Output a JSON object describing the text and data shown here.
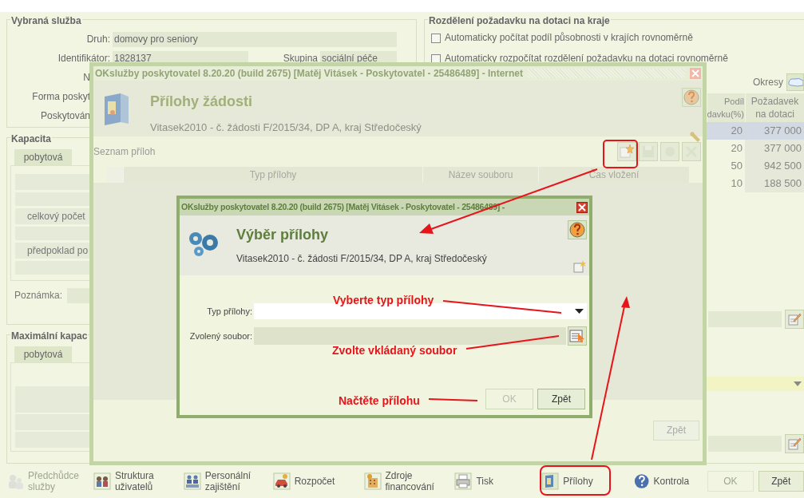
{
  "selected_service": {
    "title": "Vybraná služba",
    "rows": [
      {
        "label": "Druh:",
        "value": "domovy pro seniory"
      },
      {
        "label": "Identifikátor:",
        "value": "1828137",
        "extra_label": "Skupina",
        "extra_value": "sociální péče"
      },
      {
        "label": "N"
      },
      {
        "label": "Forma poskyt"
      },
      {
        "label": "Poskytován"
      }
    ]
  },
  "capacity": {
    "title": "Kapacita",
    "tabs": [
      {
        "label": "pobytová",
        "selected": true
      }
    ],
    "rows": [
      "celkový počet",
      "předpoklad po"
    ],
    "note_label": "Poznámka:"
  },
  "max_capacity": {
    "title": "Maximální kapac",
    "tabs": [
      {
        "label": "pobytová",
        "selected": true
      }
    ]
  },
  "region_split": {
    "title": "Rozdělení požadavku na dotaci na kraje",
    "options": [
      {
        "label": "Automaticky počítat podíl působnosti v krajích rovnoměrně",
        "checked": false
      },
      {
        "label": "Automaticky rozpočítat rozdělení požadavku na dotaci rovnoměrně",
        "checked": false
      }
    ],
    "districts_label": "Okresy",
    "columns": [
      {
        "lines": [
          "Podíl",
          "davku(%)"
        ]
      },
      {
        "lines": [
          "Požadavek",
          "na dotaci"
        ]
      }
    ],
    "rows": [
      {
        "cells": [
          "20",
          "377 000"
        ],
        "selected": true
      },
      {
        "cells": [
          "20",
          "377 000"
        ],
        "selected": false
      },
      {
        "cells": [
          "50",
          "942 500"
        ],
        "selected": false
      },
      {
        "cells": [
          "10",
          "188 500"
        ],
        "selected": false
      }
    ]
  },
  "toolbar": {
    "items": [
      {
        "label": "Předchůdce služby",
        "disabled": true
      },
      {
        "label": "Struktura uživatelů",
        "disabled": false
      },
      {
        "label": "Personální zajištění",
        "disabled": false
      },
      {
        "label": "Rozpočet",
        "disabled": false
      },
      {
        "label": "Zdroje financování",
        "disabled": false
      },
      {
        "label": "Tisk",
        "disabled": false
      },
      {
        "label": "Přílohy",
        "disabled": false
      },
      {
        "label": "Kontrola",
        "disabled": false
      }
    ],
    "buttons": [
      {
        "label": "OK",
        "disabled": true
      },
      {
        "label": "Zpět",
        "disabled": false
      }
    ]
  },
  "attachments_dialog": {
    "title_bar": "OKslužby poskytovatel 8.20.20 (build 2675)  [Matěj Vitásek - Poskytovatel - 25486489] - Internet",
    "title": "Přílohy žádosti",
    "subtitle": "Vitasek2010 - č. žádosti F/2015/34, DP A, kraj Středočeský",
    "list_label": "Seznam příloh",
    "columns": [
      "Typ přílohy",
      "Název souboru",
      "Čas vložení"
    ],
    "buttons": [
      "Zpět"
    ]
  },
  "select_dialog": {
    "title_bar": "OKslužby poskytovatel 8.20.20 (build 2675)  [Matěj Vitásek - Poskytovatel - 25486489] -",
    "title": "Výběr přílohy",
    "subtitle": "Vitasek2010 - č. žádosti F/2015/34, DP A, kraj Středočeský",
    "fields": [
      {
        "label": "Typ přílohy:",
        "kind": "select"
      },
      {
        "label": "Zvolený soubor:",
        "kind": "file"
      }
    ],
    "buttons": [
      {
        "label": "OK",
        "disabled": true
      },
      {
        "label": "Zpět",
        "disabled": false
      }
    ]
  },
  "annotations": [
    {
      "text": "Vyberte typ přílohy"
    },
    {
      "text": "Zvolte vkládaný soubor"
    },
    {
      "text": "Načtěte přílohu"
    }
  ]
}
